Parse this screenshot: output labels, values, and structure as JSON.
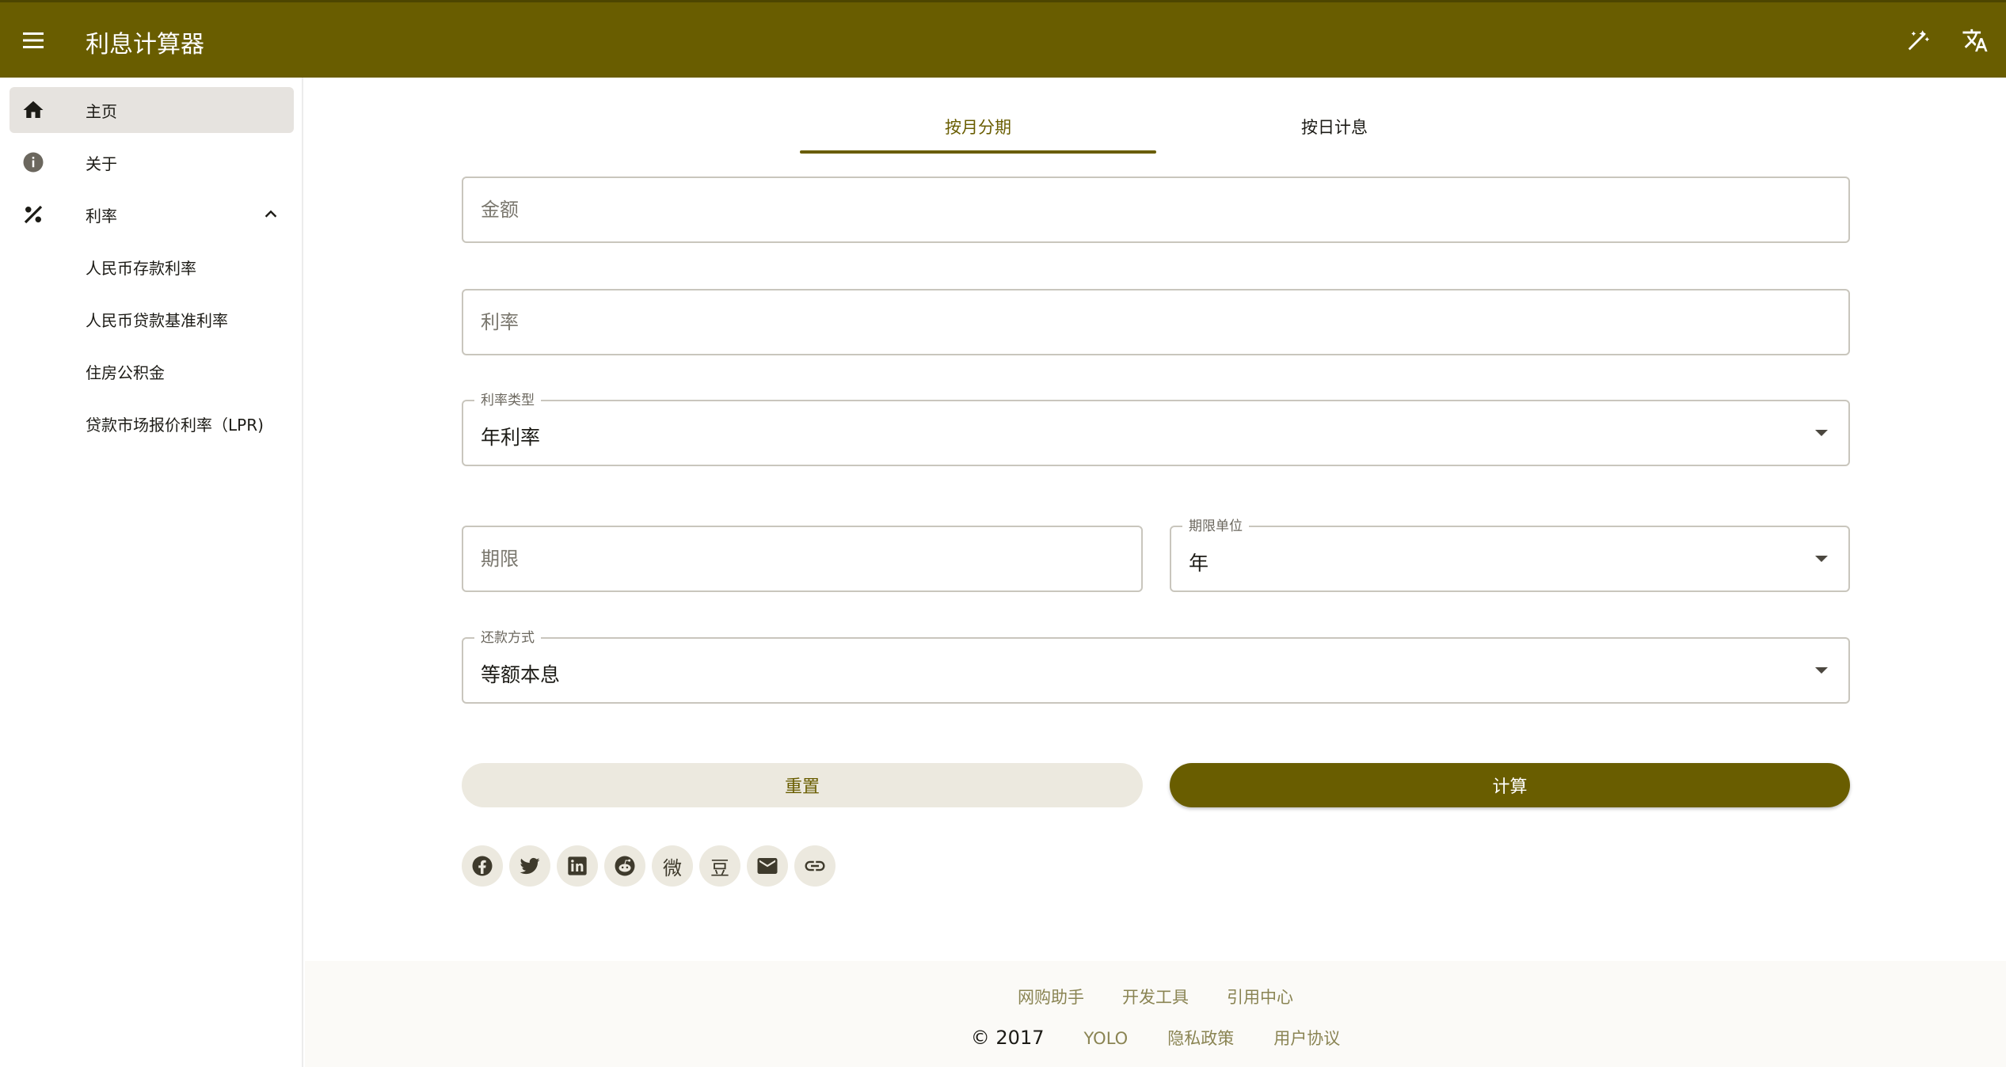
{
  "app": {
    "title": "利息计算器"
  },
  "sidebar": {
    "items": [
      {
        "label": "主页",
        "icon": "home-icon"
      },
      {
        "label": "关于",
        "icon": "info-icon"
      },
      {
        "label": "利率",
        "icon": "percent-icon"
      }
    ],
    "sub_items": [
      {
        "label": "人民币存款利率"
      },
      {
        "label": "人民币贷款基准利率"
      },
      {
        "label": "住房公积金"
      },
      {
        "label": "贷款市场报价利率（LPR)"
      }
    ]
  },
  "tabs": [
    {
      "label": "按月分期"
    },
    {
      "label": "按日计息"
    }
  ],
  "form": {
    "amount": {
      "placeholder": "金额",
      "value": ""
    },
    "rate": {
      "placeholder": "利率",
      "value": ""
    },
    "rate_type": {
      "label": "利率类型",
      "value": "年利率"
    },
    "term": {
      "placeholder": "期限",
      "value": ""
    },
    "term_unit": {
      "label": "期限单位",
      "value": "年"
    },
    "repayment": {
      "label": "还款方式",
      "value": "等额本息"
    }
  },
  "buttons": {
    "reset": "重置",
    "calculate": "计算"
  },
  "share": {
    "weibo_glyph": "微",
    "douban_glyph": "豆"
  },
  "footer": {
    "links_top": [
      "网购助手",
      "开发工具",
      "引用中心"
    ],
    "copyright": "© 2017",
    "links_bottom": [
      "YOLO",
      "隐私政策",
      "用户协议"
    ]
  },
  "colors": {
    "primary": "#695d00",
    "surface": "#ffffff",
    "tonal": "#ece9df"
  }
}
